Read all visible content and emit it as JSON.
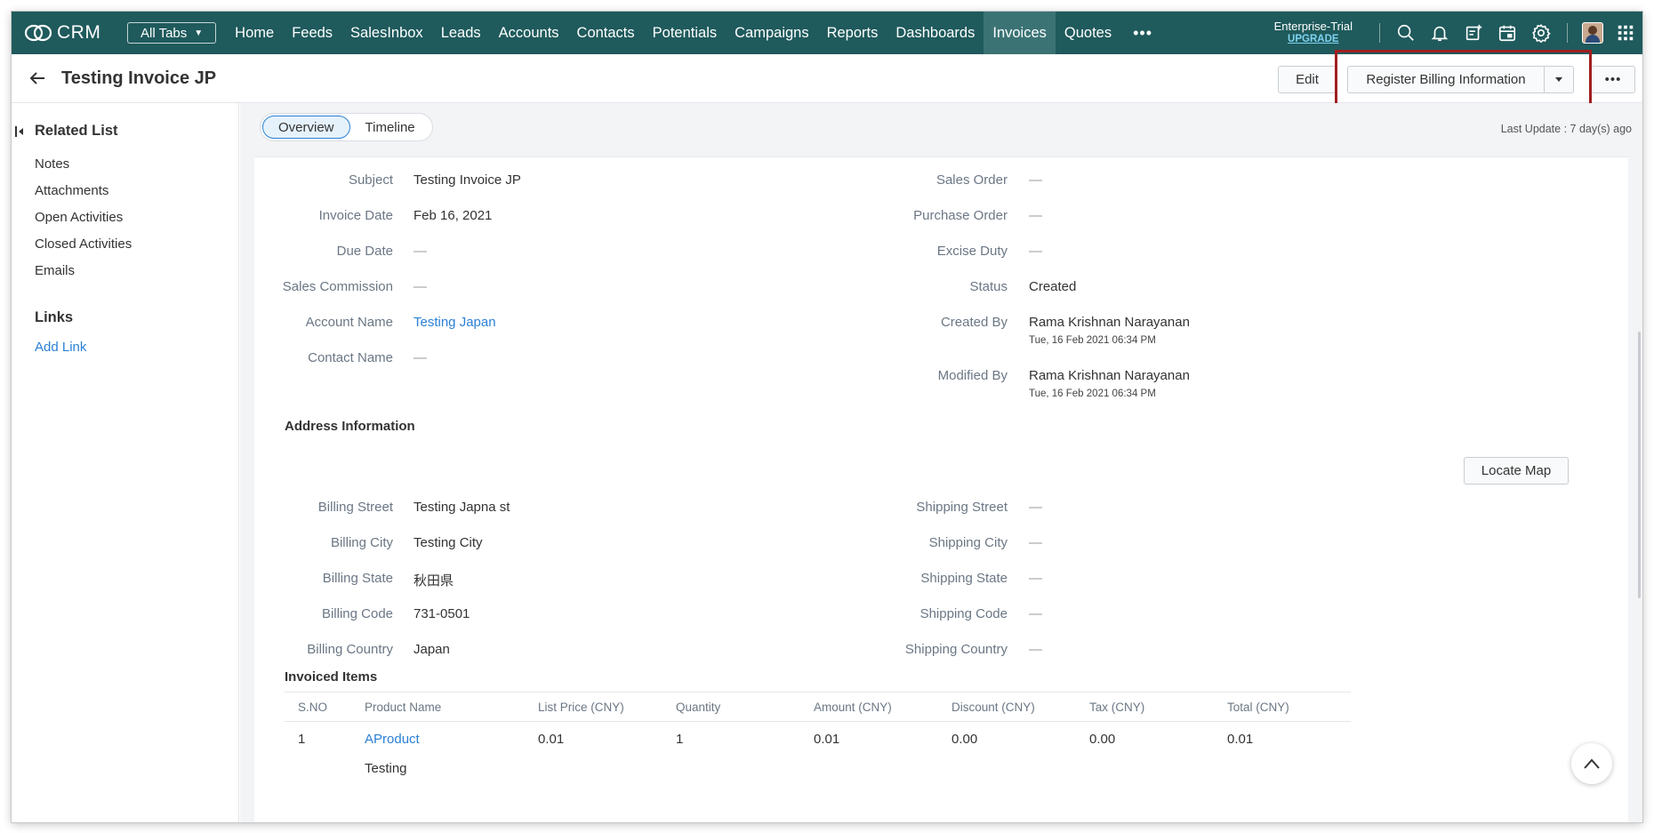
{
  "app": {
    "logo_text": "CRM"
  },
  "nav": {
    "all_tabs": "All Tabs",
    "tabs": [
      "Home",
      "Feeds",
      "SalesInbox",
      "Leads",
      "Accounts",
      "Contacts",
      "Potentials",
      "Campaigns",
      "Reports",
      "Dashboards",
      "Invoices",
      "Quotes"
    ],
    "active_tab": "Invoices",
    "more": "•••",
    "trial": "Enterprise-Trial",
    "upgrade": "UPGRADE"
  },
  "header": {
    "title": "Testing Invoice JP",
    "edit": "Edit",
    "register": "Register Billing Information",
    "more": "•••"
  },
  "sidebar": {
    "related_heading": "Related List",
    "related_items": [
      "Notes",
      "Attachments",
      "Open Activities",
      "Closed Activities",
      "Emails"
    ],
    "links_heading": "Links",
    "add_link": "Add Link"
  },
  "view_toggle": {
    "overview": "Overview",
    "timeline": "Timeline",
    "selected": "Overview"
  },
  "last_update": "Last Update : 7 day(s) ago",
  "details": {
    "left": [
      {
        "label": "Subject",
        "value": "Testing Invoice JP"
      },
      {
        "label": "Invoice Date",
        "value": "Feb 16, 2021"
      },
      {
        "label": "Due Date",
        "value": "—"
      },
      {
        "label": "Sales Commission",
        "value": "—"
      },
      {
        "label": "Account Name",
        "value": "Testing Japan"
      },
      {
        "label": "Contact Name",
        "value": "—"
      }
    ],
    "right": [
      {
        "label": "Sales Order",
        "value": "—"
      },
      {
        "label": "Purchase Order",
        "value": "—"
      },
      {
        "label": "Excise Duty",
        "value": "—"
      },
      {
        "label": "Status",
        "value": "Created"
      },
      {
        "label": "Created By",
        "value": "Rama Krishnan Narayanan",
        "sub": "Tue, 16 Feb 2021 06:34 PM"
      },
      {
        "label": "Modified By",
        "value": "Rama Krishnan Narayanan",
        "sub": "Tue, 16 Feb 2021 06:34 PM"
      }
    ]
  },
  "address": {
    "heading": "Address Information",
    "locate_map": "Locate Map",
    "left": [
      {
        "label": "Billing Street",
        "value": "Testing Japna st"
      },
      {
        "label": "Billing City",
        "value": "Testing City"
      },
      {
        "label": "Billing State",
        "value": "秋田県"
      },
      {
        "label": "Billing Code",
        "value": "731-0501"
      },
      {
        "label": "Billing Country",
        "value": "Japan"
      }
    ],
    "right": [
      {
        "label": "Shipping Street",
        "value": "—"
      },
      {
        "label": "Shipping City",
        "value": "—"
      },
      {
        "label": "Shipping State",
        "value": "—"
      },
      {
        "label": "Shipping Code",
        "value": "—"
      },
      {
        "label": "Shipping Country",
        "value": "—"
      }
    ]
  },
  "items": {
    "heading": "Invoiced Items",
    "columns": [
      "S.NO",
      "Product Name",
      "List Price (CNY)",
      "Quantity",
      "Amount (CNY)",
      "Discount (CNY)",
      "Tax (CNY)",
      "Total (CNY)"
    ],
    "rows": [
      {
        "sno": "1",
        "product": "AProduct",
        "description": "Testing",
        "list_price": "0.01",
        "quantity": "1",
        "amount": "0.01",
        "discount": "0.00",
        "tax": "0.00",
        "total": "0.01"
      }
    ]
  },
  "colors": {
    "nav_bg": "#1f5a5c",
    "active_tab": "#3b7375",
    "link": "#2b80d6",
    "highlight": "#a11f20"
  }
}
